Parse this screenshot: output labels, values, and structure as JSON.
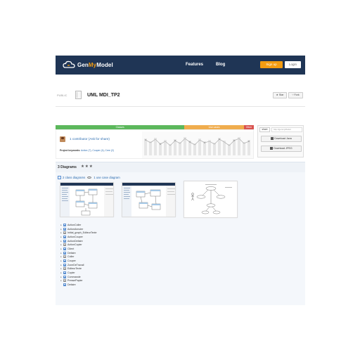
{
  "header": {
    "brand_prefix": "Gen",
    "brand_highlight": "My",
    "brand_suffix": "Model",
    "nav": [
      "Features",
      "Blog"
    ],
    "signup_label": "Sign up",
    "login_label": "Login"
  },
  "project": {
    "visibility": "PUBLIC",
    "title": "UML MDI_TP2",
    "star_label": "★ Star",
    "fork_label": "⑂ Fork"
  },
  "progress": {
    "segments": [
      {
        "label": "Classes",
        "fraction": 0.65,
        "color": "#5cb85c"
      },
      {
        "label": "Use cases",
        "fraction": 0.3,
        "color": "#f0ad4e"
      },
      {
        "label": "Other",
        "fraction": 0.05,
        "color": "#d9534f"
      }
    ]
  },
  "contributors": {
    "link_text": "1 contributor (Ask for share)",
    "keywords_label": "Project keywords:",
    "keywords": [
      "Action (7)",
      "Couper (4)",
      "Cree (2)"
    ],
    "keywords_sep": ", "
  },
  "side": {
    "share_tab": "share",
    "share_url": "http://genmyModel",
    "download_java": "Download Java",
    "download_jpeg": "Download JPEG"
  },
  "diagrams": {
    "title": "3 Diagrams",
    "stars": "★★★",
    "class_link": "2 class diagrams",
    "usecase_link": "1 use case diagram"
  },
  "tree": [
    {
      "label": "ActionColler",
      "expandable": true
    },
    {
      "label": "ActionAnnuler",
      "expandable": true
    },
    {
      "label": "Initial_graph_EditeurTexte",
      "expandable": true
    },
    {
      "label": "ActionCouper",
      "expandable": true
    },
    {
      "label": "ActionDefaire",
      "expandable": true
    },
    {
      "label": "ActionCopier",
      "expandable": true
    },
    {
      "label": "Client",
      "expandable": true
    },
    {
      "label": "Defaire",
      "expandable": true
    },
    {
      "label": "Coller",
      "expandable": true
    },
    {
      "label": "Couper",
      "expandable": true
    },
    {
      "label": "ZoneDeTravail",
      "expandable": true
    },
    {
      "label": "EditeurTexte",
      "expandable": true
    },
    {
      "label": "Copier",
      "expandable": true
    },
    {
      "label": "Commande",
      "expandable": true
    },
    {
      "label": "PressePapier",
      "expandable": true
    },
    {
      "label": "Defaire",
      "expandable": false
    }
  ],
  "colors": {
    "topbar": "#1f3555",
    "accent": "#f39c12",
    "link": "#2b6cb0"
  }
}
